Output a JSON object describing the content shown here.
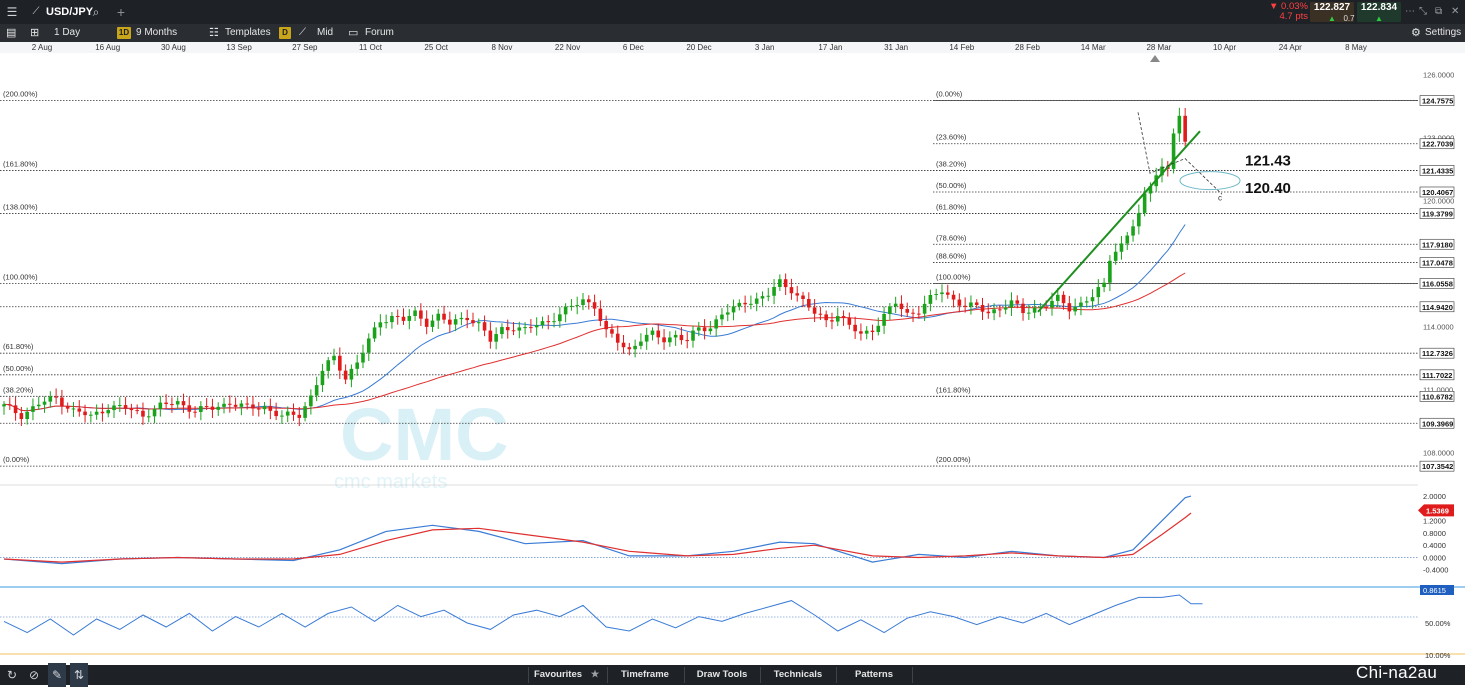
{
  "header": {
    "symbol": "USD/JPY",
    "change_pct": "▼ 0.03%",
    "change_pts": "4.7 pts",
    "sell_price": "122.827",
    "buy_price": "122.834",
    "spread": "0.7",
    "sell_arrow": "▲",
    "buy_arrow": "▲"
  },
  "toolbar": {
    "interval_label": "1 Day",
    "interval_badge": "1D",
    "range_label": "9 Months",
    "templates_label": "Templates",
    "price_type_badge": "D",
    "price_type_label": "Mid",
    "forum_label": "Forum",
    "settings_label": "Settings"
  },
  "bottom_bar": {
    "favourites_label": "Favourites",
    "timeframe_label": "Timeframe",
    "draw_tools_label": "Draw Tools",
    "technicals_label": "Technicals",
    "patterns_label": "Patterns"
  },
  "site_watermark": "Chi-na2au",
  "colors": {
    "bull_candle": "#1aa31a",
    "bear_candle": "#e01b1b",
    "ma_fast": "#3a7bd5",
    "ma_slow": "#e03030",
    "trendline": "#1f8f1f",
    "toolbar_bg": "#2a2e33",
    "topbar_bg": "#1e2227"
  },
  "chart_data": {
    "type": "candlestick",
    "x_tick_labels": [
      "2 Aug",
      "16 Aug",
      "30 Aug",
      "13 Sep",
      "27 Sep",
      "11 Oct",
      "25 Oct",
      "8 Nov",
      "22 Nov",
      "6 Dec",
      "20 Dec",
      "3 Jan",
      "17 Jan",
      "31 Jan",
      "14 Feb",
      "28 Feb",
      "14 Mar",
      "28 Mar",
      "10 Apr",
      "24 Apr",
      "8 May"
    ],
    "y_ticks": [
      "126.0000",
      "123.0000",
      "120.0000",
      "114.0000",
      "111.0000",
      "108.0000"
    ],
    "ylim": [
      106.6,
      126.5
    ],
    "close_path": [
      [
        0,
        110.2
      ],
      [
        3,
        109.8
      ],
      [
        6,
        110.3
      ],
      [
        9,
        110.6
      ],
      [
        12,
        110.0
      ],
      [
        15,
        109.7
      ],
      [
        18,
        110.2
      ],
      [
        21,
        110.1
      ],
      [
        24,
        109.8
      ],
      [
        27,
        110.2
      ],
      [
        30,
        110.4
      ],
      [
        33,
        110.0
      ],
      [
        36,
        110.1
      ],
      [
        39,
        110.4
      ],
      [
        42,
        110.1
      ],
      [
        45,
        110.2
      ],
      [
        48,
        109.7
      ],
      [
        51,
        109.8
      ],
      [
        53,
        110.7
      ],
      [
        55,
        111.9
      ],
      [
        57,
        112.5
      ],
      [
        59,
        111.6
      ],
      [
        61,
        112.3
      ],
      [
        63,
        113.3
      ],
      [
        65,
        114.3
      ],
      [
        67,
        114.5
      ],
      [
        69,
        114.3
      ],
      [
        71,
        114.6
      ],
      [
        73,
        114.2
      ],
      [
        75,
        114.5
      ],
      [
        77,
        114.1
      ],
      [
        80,
        114.5
      ],
      [
        82,
        114.1
      ],
      [
        84,
        113.3
      ],
      [
        86,
        113.9
      ],
      [
        88,
        114.0
      ],
      [
        90,
        113.8
      ],
      [
        92,
        114.1
      ],
      [
        94,
        114.3
      ],
      [
        96,
        114.6
      ],
      [
        98,
        114.9
      ],
      [
        100,
        115.3
      ],
      [
        102,
        115.0
      ],
      [
        104,
        113.7
      ],
      [
        106,
        113.3
      ],
      [
        108,
        112.9
      ],
      [
        110,
        113.4
      ],
      [
        112,
        113.6
      ],
      [
        114,
        113.4
      ],
      [
        116,
        113.6
      ],
      [
        118,
        113.3
      ],
      [
        120,
        113.9
      ],
      [
        122,
        114.0
      ],
      [
        124,
        114.6
      ],
      [
        126,
        114.8
      ],
      [
        128,
        115.2
      ],
      [
        130,
        115.3
      ],
      [
        132,
        115.5
      ],
      [
        134,
        116.1
      ],
      [
        136,
        115.8
      ],
      [
        138,
        115.2
      ],
      [
        140,
        114.6
      ],
      [
        142,
        114.3
      ],
      [
        144,
        114.6
      ],
      [
        146,
        114.0
      ],
      [
        148,
        113.6
      ],
      [
        150,
        113.9
      ],
      [
        152,
        114.5
      ],
      [
        154,
        115.1
      ],
      [
        156,
        114.6
      ],
      [
        158,
        114.8
      ],
      [
        160,
        115.3
      ],
      [
        162,
        115.7
      ],
      [
        164,
        115.3
      ],
      [
        166,
        115.0
      ],
      [
        168,
        114.9
      ],
      [
        170,
        114.7
      ],
      [
        172,
        114.9
      ],
      [
        174,
        115.1
      ],
      [
        176,
        114.7
      ],
      [
        178,
        114.9
      ],
      [
        180,
        115.0
      ],
      [
        182,
        115.3
      ],
      [
        184,
        114.9
      ],
      [
        186,
        115.1
      ],
      [
        188,
        115.4
      ],
      [
        190,
        116.0
      ],
      [
        191,
        117.3
      ],
      [
        192,
        117.7
      ],
      [
        193,
        117.9
      ],
      [
        194,
        118.3
      ],
      [
        195,
        118.8
      ],
      [
        196,
        119.3
      ],
      [
        197,
        120.2
      ],
      [
        198,
        120.8
      ],
      [
        199,
        121.4
      ],
      [
        200,
        121.6
      ],
      [
        201,
        121.4
      ],
      [
        202,
        123.2
      ],
      [
        203,
        124.0
      ],
      [
        204,
        122.8
      ]
    ],
    "fibonacci_left": {
      "labels": [
        "(200.00%)",
        "(161.80%)",
        "(138.00%)",
        "(100.00%)",
        "(61.80%)",
        "(50.00%)",
        "(38.20%)",
        "(0.00%)"
      ],
      "prices": [
        124.7575,
        121.4335,
        119.3799,
        116.0558,
        112.7326,
        111.7022,
        110.6782,
        107.3542
      ]
    },
    "fibonacci_right": {
      "labels": [
        "(0.00%)",
        "(23.60%)",
        "(38.20%)",
        "(50.00%)",
        "(61.80%)",
        "(78.60%)",
        "(88.60%)",
        "(100.00%)",
        "(161.80%)",
        "(200.00%)"
      ],
      "prices": [
        124.7575,
        122.7039,
        121.4335,
        120.4067,
        119.3799,
        117.918,
        117.0478,
        116.0558,
        110.6782,
        107.3542
      ]
    },
    "fib_price_labels": [
      "124.7575",
      "122.7039",
      "121.4335",
      "120.4067",
      "119.3799",
      "117.9180",
      "117.0478",
      "116.0558",
      "114.9420",
      "112.7326",
      "111.7022",
      "110.6782",
      "109.3969",
      "107.3542"
    ],
    "fib_price_values": [
      124.7575,
      122.7039,
      121.4335,
      120.4067,
      119.3799,
      117.918,
      117.0478,
      116.0558,
      114.942,
      112.7326,
      111.7022,
      110.6782,
      109.3969,
      107.3542
    ],
    "annotations": [
      "121.43",
      "120.40"
    ],
    "pattern_label": "c",
    "macd_panel": {
      "y_ticks": [
        "2.0000",
        "1.2000",
        "0.8000",
        "0.4000",
        "0.0000",
        "-0.4000"
      ],
      "tick_values": [
        2.0,
        1.2,
        0.8,
        0.4,
        0.0,
        -0.4
      ],
      "ylim": [
        -0.8,
        2.2
      ],
      "current_value": "1.5369",
      "macd": [
        [
          0,
          -0.05
        ],
        [
          10,
          -0.2
        ],
        [
          20,
          -0.05
        ],
        [
          30,
          0.0
        ],
        [
          40,
          -0.05
        ],
        [
          50,
          -0.1
        ],
        [
          58,
          0.25
        ],
        [
          66,
          0.85
        ],
        [
          74,
          1.05
        ],
        [
          82,
          0.85
        ],
        [
          90,
          0.45
        ],
        [
          100,
          0.55
        ],
        [
          108,
          0.05
        ],
        [
          118,
          0.05
        ],
        [
          126,
          0.2
        ],
        [
          134,
          0.5
        ],
        [
          140,
          0.45
        ],
        [
          150,
          -0.15
        ],
        [
          158,
          0.1
        ],
        [
          166,
          0.0
        ],
        [
          174,
          0.2
        ],
        [
          182,
          0.05
        ],
        [
          190,
          0.0
        ],
        [
          195,
          0.25
        ],
        [
          200,
          1.2
        ],
        [
          204,
          1.95
        ],
        [
          205,
          2.0
        ]
      ],
      "signal": [
        [
          0,
          -0.05
        ],
        [
          10,
          -0.15
        ],
        [
          20,
          -0.05
        ],
        [
          30,
          0.0
        ],
        [
          40,
          -0.05
        ],
        [
          50,
          -0.05
        ],
        [
          58,
          0.1
        ],
        [
          66,
          0.55
        ],
        [
          74,
          0.9
        ],
        [
          82,
          0.95
        ],
        [
          90,
          0.75
        ],
        [
          100,
          0.5
        ],
        [
          108,
          0.2
        ],
        [
          118,
          0.05
        ],
        [
          126,
          0.1
        ],
        [
          134,
          0.3
        ],
        [
          140,
          0.4
        ],
        [
          150,
          0.05
        ],
        [
          158,
          0.0
        ],
        [
          166,
          0.05
        ],
        [
          174,
          0.15
        ],
        [
          182,
          0.05
        ],
        [
          190,
          0.0
        ],
        [
          195,
          0.1
        ],
        [
          200,
          0.75
        ],
        [
          204,
          1.3
        ],
        [
          205,
          1.45
        ]
      ]
    },
    "stoch_panel": {
      "y_ticks": [
        "50.00%",
        "10.00%"
      ],
      "tick_values": [
        50,
        10
      ],
      "ylim": [
        5,
        95
      ],
      "current_value": "0.8615",
      "values": [
        [
          0,
          52
        ],
        [
          4,
          38
        ],
        [
          8,
          55
        ],
        [
          12,
          35
        ],
        [
          16,
          55
        ],
        [
          20,
          42
        ],
        [
          24,
          60
        ],
        [
          28,
          45
        ],
        [
          32,
          62
        ],
        [
          36,
          40
        ],
        [
          40,
          58
        ],
        [
          44,
          45
        ],
        [
          48,
          62
        ],
        [
          52,
          45
        ],
        [
          56,
          62
        ],
        [
          60,
          70
        ],
        [
          64,
          52
        ],
        [
          68,
          72
        ],
        [
          72,
          58
        ],
        [
          76,
          66
        ],
        [
          80,
          50
        ],
        [
          84,
          42
        ],
        [
          88,
          60
        ],
        [
          92,
          66
        ],
        [
          96,
          58
        ],
        [
          100,
          72
        ],
        [
          104,
          45
        ],
        [
          108,
          40
        ],
        [
          112,
          55
        ],
        [
          116,
          44
        ],
        [
          120,
          58
        ],
        [
          124,
          52
        ],
        [
          128,
          62
        ],
        [
          132,
          70
        ],
        [
          136,
          78
        ],
        [
          140,
          60
        ],
        [
          144,
          40
        ],
        [
          148,
          54
        ],
        [
          152,
          38
        ],
        [
          156,
          56
        ],
        [
          160,
          64
        ],
        [
          164,
          58
        ],
        [
          168,
          48
        ],
        [
          172,
          58
        ],
        [
          176,
          50
        ],
        [
          180,
          62
        ],
        [
          184,
          48
        ],
        [
          188,
          60
        ],
        [
          192,
          72
        ],
        [
          196,
          82
        ],
        [
          200,
          82
        ],
        [
          203,
          85
        ],
        [
          205,
          74
        ],
        [
          207,
          74
        ]
      ]
    }
  }
}
